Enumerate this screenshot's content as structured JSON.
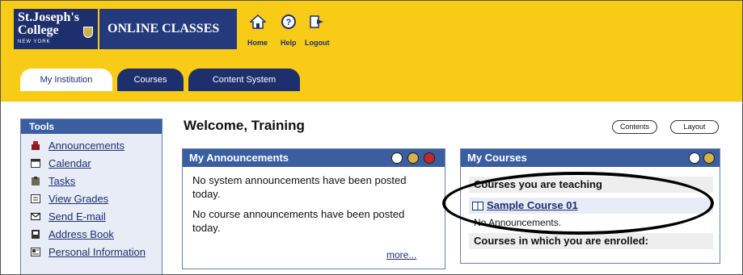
{
  "brand": {
    "logo_lines": [
      "St.Joseph's",
      "College",
      "NEW YORK"
    ],
    "banner": "ONLINE CLASSES"
  },
  "topnav": {
    "home": "Home",
    "help": "Help",
    "logout": "Logout"
  },
  "tabs": [
    {
      "label": "My Institution",
      "active": true
    },
    {
      "label": "Courses",
      "active": false
    },
    {
      "label": "Content System",
      "active": false
    }
  ],
  "tools": {
    "title": "Tools",
    "items": [
      {
        "label": "Announcements",
        "icon": "announcements-icon"
      },
      {
        "label": "Calendar",
        "icon": "calendar-icon"
      },
      {
        "label": "Tasks",
        "icon": "tasks-icon"
      },
      {
        "label": "View Grades",
        "icon": "grades-icon"
      },
      {
        "label": "Send E-mail",
        "icon": "email-icon"
      },
      {
        "label": "Address Book",
        "icon": "address-book-icon"
      },
      {
        "label": "Personal Information",
        "icon": "personal-info-icon"
      }
    ]
  },
  "main": {
    "welcome": "Welcome, Training",
    "contents_button": "Contents",
    "layout_button": "Layout"
  },
  "announcements": {
    "title": "My Announcements",
    "system": "No system announcements have been posted today.",
    "course": "No course announcements have been posted today.",
    "more": "more..."
  },
  "courses": {
    "title": "My Courses",
    "teaching_heading": "Courses you are teaching",
    "course_name": "Sample Course 01",
    "no_announcements": "No Announcements.",
    "enrolled_heading": "Courses in which you are enrolled:"
  },
  "colors": {
    "header_yellow": "#f7cb16",
    "navy": "#1e2f6e",
    "module_blue": "#3a5ea0"
  }
}
